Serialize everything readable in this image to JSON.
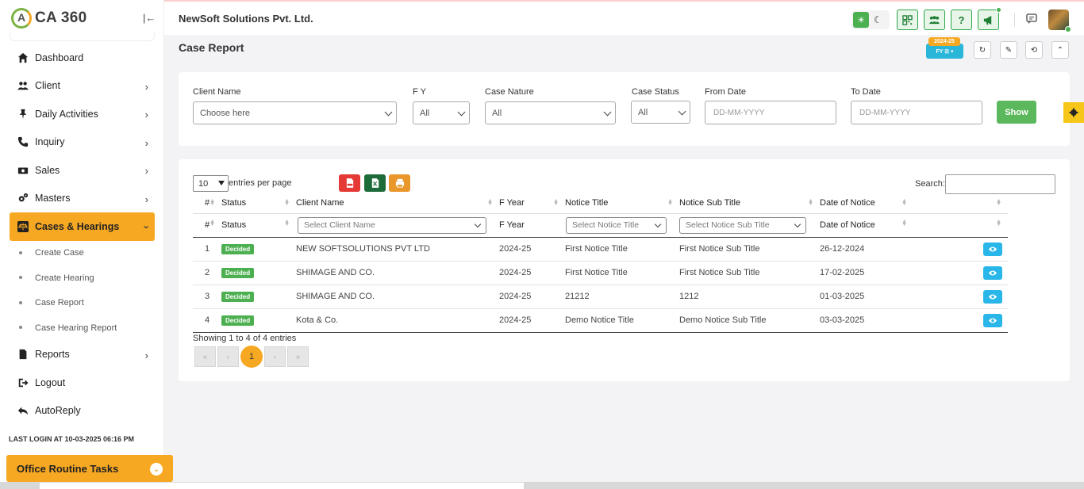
{
  "app": {
    "logo_text": "CA 360",
    "company_name": "NewSoft Solutions Pvt. Ltd.",
    "collapse_glyph": "|←"
  },
  "sidebar": {
    "items": [
      {
        "label": "Dashboard",
        "icon": "home-icon"
      },
      {
        "label": "Client",
        "icon": "users-icon"
      },
      {
        "label": "Daily Activities",
        "icon": "pin-icon"
      },
      {
        "label": "Inquiry",
        "icon": "phone-icon"
      },
      {
        "label": "Sales",
        "icon": "money-icon"
      },
      {
        "label": "Masters",
        "icon": "gears-icon"
      },
      {
        "label": "Cases & Hearings",
        "icon": "scale-icon"
      }
    ],
    "sub_items": [
      "Create Case",
      "Create Hearing",
      "Case Report",
      "Case Hearing Report"
    ],
    "items_after": [
      {
        "label": "Reports",
        "icon": "file-icon"
      },
      {
        "label": "Logout",
        "icon": "logout-icon"
      },
      {
        "label": "AutoReply",
        "icon": "reply-icon"
      }
    ],
    "last_login": "LAST LOGIN AT 10-03-2025 06:16 PM",
    "office_tasks": "Office Routine Tasks"
  },
  "page": {
    "title": "Case Report",
    "fy_tag": "2024-25",
    "fy_badge": "FY ⊞ ▾"
  },
  "filters": {
    "client_name_label": "Client Name",
    "client_name_value": "Choose here",
    "fy_label": "F Y",
    "fy_value": "All",
    "case_nature_label": "Case Nature",
    "case_nature_value": "All",
    "case_status_label": "Case Status",
    "case_status_value": "All",
    "from_date_label": "From Date",
    "from_date_placeholder": "DD-MM-YYYY",
    "to_date_label": "To Date",
    "to_date_placeholder": "DD-MM-YYYY",
    "show_label": "Show"
  },
  "table": {
    "page_length": "10",
    "entries_text": "entries per page",
    "search_label": "Search:",
    "columns": [
      "#",
      "Status",
      "Client Name",
      "F Year",
      "Notice Title",
      "Notice Sub Title",
      "Date of Notice",
      ""
    ],
    "filter_row": {
      "num": "#",
      "status": "Status",
      "client_placeholder": "Select Client Name",
      "fyear": "F Year",
      "notice_title_placeholder": "Select Notice Title",
      "notice_sub_placeholder": "Select Notice Sub Title",
      "date": "Date of Notice"
    },
    "rows": [
      {
        "no": "1",
        "status": "Decided",
        "client": "NEW SOFTSOLUTIONS PVT LTD",
        "fyear": "2024-25",
        "title": "First Notice Title",
        "sub": "First Notice Sub Title",
        "date": "26-12-2024"
      },
      {
        "no": "2",
        "status": "Decided",
        "client": "SHIMAGE AND CO.",
        "fyear": "2024-25",
        "title": "First Notice Title",
        "sub": "First Notice Sub Title",
        "date": "17-02-2025"
      },
      {
        "no": "3",
        "status": "Decided",
        "client": "SHIMAGE AND CO.",
        "fyear": "2024-25",
        "title": "21212",
        "sub": "1212",
        "date": "01-03-2025"
      },
      {
        "no": "4",
        "status": "Decided",
        "client": "Kota & Co.",
        "fyear": "2024-25",
        "title": "Demo Notice Title",
        "sub": "Demo Notice Sub Title",
        "date": "03-03-2025"
      }
    ],
    "showing": "Showing 1 to 4 of 4 entries",
    "pager": {
      "first": "«",
      "prev": "‹",
      "current": "1",
      "next": "›",
      "last": "»"
    }
  },
  "colors": {
    "accent": "#f7a823",
    "success": "#5cb85c",
    "info": "#29b6e8"
  }
}
